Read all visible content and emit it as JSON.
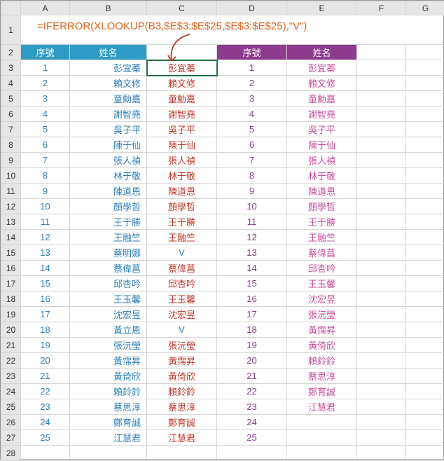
{
  "formula": "=IFERROR(XLOOKUP(B3,$E$3:$E$25,$E$3:$E$25),\"V\")",
  "columns": [
    "A",
    "B",
    "C",
    "D",
    "E",
    "F",
    "G"
  ],
  "headers": {
    "left": {
      "seq": "序號",
      "name": "姓名"
    },
    "right": {
      "seq": "序號",
      "name": "姓名"
    }
  },
  "chart_data": {
    "type": "table",
    "title": "XLOOKUP comparison of two name lists",
    "rows": [
      {
        "r": 3,
        "a": 1,
        "b": "彭宜蓁",
        "c": "彭宜蓁",
        "cc": "red",
        "d": 1,
        "e": "彭宜蓁"
      },
      {
        "r": 4,
        "a": 2,
        "b": "賴文修",
        "c": "賴文修",
        "cc": "red",
        "d": 2,
        "e": "賴文修"
      },
      {
        "r": 5,
        "a": 3,
        "b": "童勳嘉",
        "c": "童勳嘉",
        "cc": "red",
        "d": 3,
        "e": "童勳嘉"
      },
      {
        "r": 6,
        "a": 4,
        "b": "謝智堯",
        "c": "謝智堯",
        "cc": "red",
        "d": 4,
        "e": "謝智堯"
      },
      {
        "r": 7,
        "a": 5,
        "b": "吳子平",
        "c": "吳子平",
        "cc": "red",
        "d": 5,
        "e": "吳子平"
      },
      {
        "r": 8,
        "a": 6,
        "b": "陳于仙",
        "c": "陳于仙",
        "cc": "red",
        "d": 6,
        "e": "陳于仙"
      },
      {
        "r": 9,
        "a": 7,
        "b": "張人禎",
        "c": "張人禎",
        "cc": "red",
        "d": 7,
        "e": "張人禎"
      },
      {
        "r": 10,
        "a": 8,
        "b": "林于敬",
        "c": "林于敬",
        "cc": "red",
        "d": 8,
        "e": "林于敬"
      },
      {
        "r": 11,
        "a": 9,
        "b": "陳道恩",
        "c": "陳道恩",
        "cc": "red",
        "d": 9,
        "e": "陳道恩"
      },
      {
        "r": 12,
        "a": 10,
        "b": "顏學哲",
        "c": "顏學哲",
        "cc": "red",
        "d": 10,
        "e": "顏學哲"
      },
      {
        "r": 13,
        "a": 11,
        "b": "王于勝",
        "c": "王于勝",
        "cc": "red",
        "d": 11,
        "e": "王于勝"
      },
      {
        "r": 14,
        "a": 12,
        "b": "王融竺",
        "c": "王融竺",
        "cc": "red",
        "d": 12,
        "e": "王融竺"
      },
      {
        "r": 15,
        "a": 13,
        "b": "蔡明娜",
        "c": "V",
        "cc": "blue",
        "d": 13,
        "e": "蔡偉菖"
      },
      {
        "r": 16,
        "a": 14,
        "b": "蔡偉菖",
        "c": "蔡偉菖",
        "cc": "red",
        "d": 14,
        "e": "邱杏吟"
      },
      {
        "r": 17,
        "a": 15,
        "b": "邱杏吟",
        "c": "邱杏吟",
        "cc": "red",
        "d": 15,
        "e": "王玉馨"
      },
      {
        "r": 18,
        "a": 16,
        "b": "王玉馨",
        "c": "王玉馨",
        "cc": "red",
        "d": 16,
        "e": "沈宏昱"
      },
      {
        "r": 19,
        "a": 17,
        "b": "沈宏昱",
        "c": "沈宏昱",
        "cc": "red",
        "d": 17,
        "e": "張沅瑩"
      },
      {
        "r": 20,
        "a": 18,
        "b": "黃立恩",
        "c": "V",
        "cc": "blue",
        "d": 18,
        "e": "黃霈昇"
      },
      {
        "r": 21,
        "a": 19,
        "b": "張沅瑩",
        "c": "張沅瑩",
        "cc": "red",
        "d": 19,
        "e": "黃倚欣"
      },
      {
        "r": 22,
        "a": 20,
        "b": "黃霈昇",
        "c": "黃霈昇",
        "cc": "red",
        "d": 20,
        "e": "賴鈴鈴"
      },
      {
        "r": 23,
        "a": 21,
        "b": "黃倚欣",
        "c": "黃倚欣",
        "cc": "red",
        "d": 21,
        "e": "蔡思淳"
      },
      {
        "r": 24,
        "a": 22,
        "b": "賴鈴鈴",
        "c": "賴鈴鈴",
        "cc": "red",
        "d": 22,
        "e": "鄭育誠"
      },
      {
        "r": 25,
        "a": 23,
        "b": "蔡思淳",
        "c": "蔡思淳",
        "cc": "red",
        "d": 23,
        "e": "江慧君"
      },
      {
        "r": 26,
        "a": 24,
        "b": "鄭育誠",
        "c": "鄭育誠",
        "cc": "red",
        "d": 24,
        "e": ""
      },
      {
        "r": 27,
        "a": 25,
        "b": "江慧君",
        "c": "江慧君",
        "cc": "red",
        "d": 25,
        "e": ""
      }
    ]
  }
}
